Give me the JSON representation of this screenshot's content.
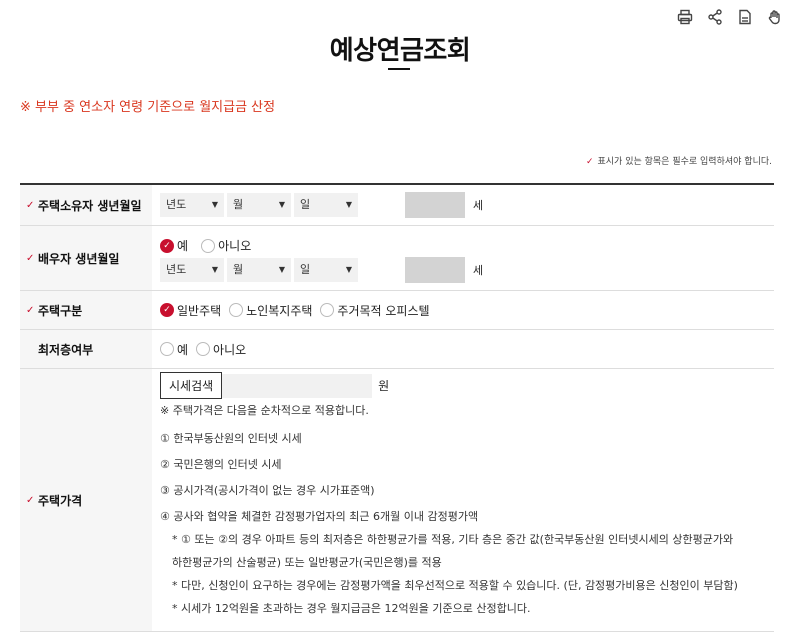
{
  "page": {
    "title": "예상연금조회",
    "notice": "※ 부부 중 연소자 연령 기준으로 월지급금 산정",
    "required_hint": "표시가 있는 항목은 필수로 입력하셔야 합니다."
  },
  "toolbar": [
    "print-icon",
    "share-icon",
    "bookmark-icon",
    "hand-icon"
  ],
  "form": {
    "owner_birth": {
      "label": "주택소유자 생년월일",
      "year": "년도",
      "month": "월",
      "day": "일",
      "age_unit": "세"
    },
    "spouse_birth": {
      "label": "배우자 생년월일",
      "yes": "예",
      "no": "아니오",
      "year": "년도",
      "month": "월",
      "day": "일",
      "age_unit": "세"
    },
    "house_type": {
      "label": "주택구분",
      "options": [
        "일반주택",
        "노인복지주택",
        "주거목적 오피스텔"
      ]
    },
    "lowest_floor": {
      "label": "최저층여부",
      "yes": "예",
      "no": "아니오"
    },
    "house_price": {
      "label": "주택가격",
      "search_button": "시세검색",
      "unit": "원",
      "lines": [
        "※ 주택가격은 다음을 순차적으로 적용합니다.",
        "① 한국부동산원의 인터넷 시세",
        "② 국민은행의 인터넷 시세",
        "③ 공시가격(공시가격이 없는 경우 시가표준액)",
        "④ 공사와 협약을 체결한 감정평가업자의 최근 6개월 이내 감정평가액",
        "* ① 또는 ②의 경우 아파트 등의 최저층은 하한평균가를 적용, 기타 층은 중간 값(한국부동산원 인터넷시세의 상한평균가와",
        "하한평균가의 산술평균) 또는 일반평균가(국민은행)를 적용",
        "* 다만, 신청인이 요구하는 경우에는 감정평가액을 최우선적으로 적용할 수 있습니다. (단, 감정평가비용은 신청인이 부담함)",
        "* 시세가 12억원을 초과하는 경우 월지급금은 12억원을 기준으로 산정합니다."
      ]
    }
  },
  "colors": {
    "accent": "#c8102e",
    "notice": "#d9371f"
  }
}
